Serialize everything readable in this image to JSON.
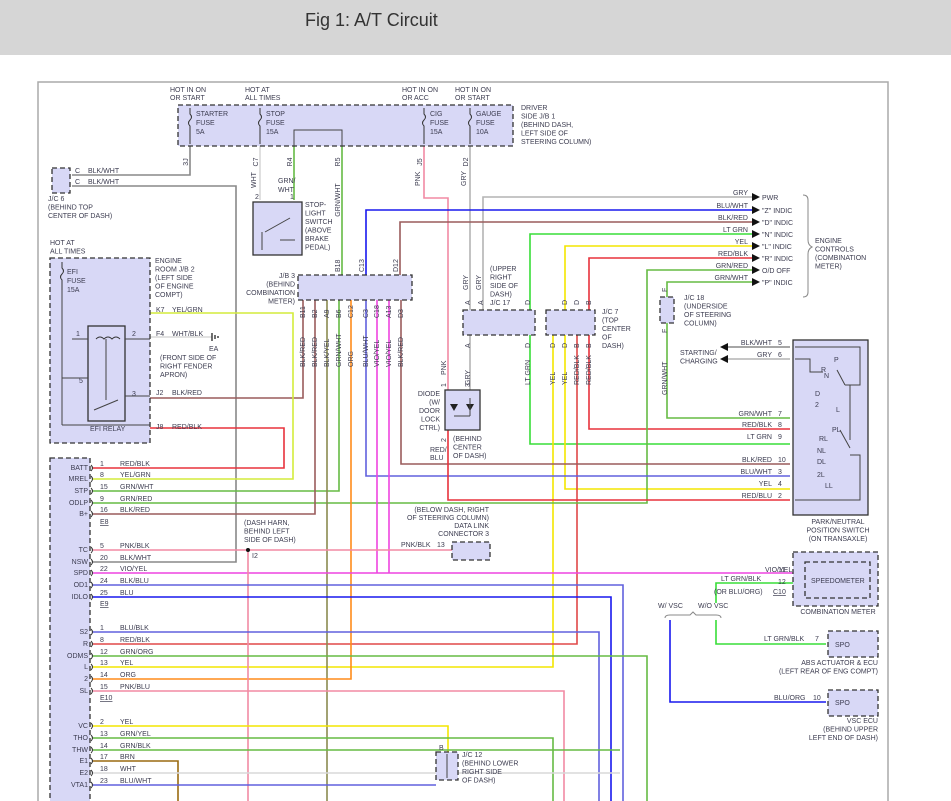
{
  "header": {
    "title": "Fig 1: A/T Circuit"
  },
  "jb1": {
    "hot": [
      [
        "HOT IN ON",
        "OR START"
      ],
      [
        "HOT AT",
        "ALL TIMES"
      ],
      [
        "HOT IN ON",
        "OR ACC"
      ],
      [
        "HOT IN ON",
        "OR START"
      ]
    ],
    "fuses": [
      [
        "STARTER",
        "FUSE",
        "5A"
      ],
      [
        "STOP",
        "FUSE",
        "15A"
      ],
      [
        "CIG",
        "FUSE",
        "15A"
      ],
      [
        "GAUGE",
        "FUSE",
        "10A"
      ]
    ],
    "label": [
      "DRIVER",
      "SIDE J/B 1",
      "(BEHIND DASH,",
      "LEFT SIDE OF",
      "STEERING COLUMN)"
    ],
    "terminals": [
      "3J",
      "C7",
      "R4",
      "R5",
      "J5",
      "D2"
    ],
    "wires": [
      "WHT",
      "GRN/",
      "WHT",
      "GRN/WHT",
      "PNK",
      "GRY"
    ]
  },
  "jc6": {
    "pins": [
      "C",
      "C"
    ],
    "wires": [
      "BLK/WHT",
      "BLK/WHT"
    ],
    "label": [
      "J/C 6",
      "(BEHIND TOP",
      "CENTER OF DASH)"
    ]
  },
  "stop_switch": {
    "pins": [
      "2",
      "1"
    ],
    "label": [
      "STOP-",
      "LIGHT",
      "SWITCH",
      "(ABOVE",
      "BRAKE",
      "PEDAL)"
    ]
  },
  "jb2": {
    "hot": [
      "HOT AT",
      "ALL TIMES"
    ],
    "fuse": [
      "EFI",
      "FUSE",
      "15A"
    ],
    "label": [
      "ENGINE",
      "ROOM J/B 2",
      "(LEFT SIDE",
      "OF ENGINE",
      "COMPT)"
    ],
    "relay": "EFI RELAY",
    "relay_pins": [
      "1",
      "2",
      "5",
      "3"
    ],
    "terminals": [
      {
        "pin": "K7",
        "wire": "YEL/GRN"
      },
      {
        "pin": "F4",
        "wire": "WHT/BLK"
      },
      {
        "pin": "J2",
        "wire": "BLK/RED"
      },
      {
        "pin": "J8",
        "wire": "RED/BLK"
      }
    ],
    "ground": {
      "name": "EA",
      "label": [
        "(FRONT SIDE OF",
        "RIGHT FENDER",
        "APRON)"
      ]
    }
  },
  "jb3": {
    "label": [
      "J/B 3",
      "(BEHIND",
      "COMBINATION",
      "METER)"
    ],
    "top_terminals": [
      "B18",
      "C13",
      "D12"
    ],
    "bottom_terminals": [
      "B11",
      "B2",
      "A9",
      "B6",
      "C12",
      "C3",
      "C18",
      "A13",
      "D3"
    ],
    "bottom_wires": [
      "BLK/RED",
      "BLK/RED",
      "BLK/YEL",
      "GRN/WHT",
      "ORG",
      "BLU/WHT",
      "VIO/YEL",
      "VIO/YEL",
      "BLK/RED"
    ]
  },
  "jc17": {
    "label": [
      "(UPPER",
      "RIGHT",
      "SIDE OF",
      "DASH)",
      "J/C 17"
    ],
    "top_pins": [
      "A",
      "A",
      "D"
    ],
    "top_wires": [
      "GRY",
      "GRY"
    ],
    "bottom_pins": [
      "A",
      "D"
    ],
    "bottom_wires": [
      "GRY",
      "LT GRN"
    ]
  },
  "jc7": {
    "label": [
      "J/C 7",
      "(TOP",
      "CENTER",
      "OF",
      "DASH)"
    ],
    "top_pins": [
      "D",
      "D",
      "B"
    ],
    "bottom_pins": [
      "D",
      "D",
      "B",
      "B"
    ],
    "bottom_wires": [
      "YEL",
      "YEL",
      "RED/BLK",
      "RED/BLK"
    ]
  },
  "diode": {
    "label": [
      "DIODE",
      "(W/",
      "DOOR",
      "LOCK",
      "CTRL)"
    ],
    "pins": [
      "1",
      "3",
      "2"
    ],
    "wires": [
      "PNK",
      "RED/",
      "BLU"
    ],
    "location": [
      "(BEHIND",
      "CENTER",
      "OF DASH)"
    ]
  },
  "jc18": {
    "pins": [
      "F",
      "F"
    ],
    "label": [
      "J/C 18",
      "(UNDERSIDE",
      "OF STEERING",
      "COLUMN)"
    ],
    "wire": "GRN/WHT"
  },
  "meter_outputs": {
    "items": [
      {
        "wire": "GRY",
        "signal": "PWR"
      },
      {
        "wire": "BLU/WHT",
        "signal": "\"Z\" INDIC"
      },
      {
        "wire": "BLK/RED",
        "signal": "\"D\" INDIC"
      },
      {
        "wire": "LT GRN",
        "signal": "\"N\" INDIC"
      },
      {
        "wire": "YEL",
        "signal": "\"L\" INDIC"
      },
      {
        "wire": "RED/BLK",
        "signal": "\"R\" INDIC"
      },
      {
        "wire": "GRN/RED",
        "signal": "O/D OFF"
      },
      {
        "wire": "GRN/WHT",
        "signal": "\"P\" INDIC"
      }
    ],
    "label": [
      "ENGINE",
      "CONTROLS",
      "(COMBINATION",
      "METER)"
    ]
  },
  "pn_switch": {
    "outputs": [
      "STARTING/",
      "CHARGING"
    ],
    "pins": [
      {
        "wire": "BLK/WHT",
        "pin": "5"
      },
      {
        "wire": "GRY",
        "pin": "6"
      },
      {
        "wire": "GRN/WHT",
        "pin": "7"
      },
      {
        "wire": "RED/BLK",
        "pin": "8"
      },
      {
        "wire": "LT GRN",
        "pin": "9"
      },
      {
        "wire": "BLK/RED",
        "pin": "10"
      },
      {
        "wire": "BLU/WHT",
        "pin": "3"
      },
      {
        "wire": "YEL",
        "pin": "4"
      },
      {
        "wire": "RED/BLU",
        "pin": "2"
      }
    ],
    "positions": [
      "P",
      "R",
      "N",
      "D",
      "2",
      "L",
      "PL",
      "RL",
      "NL",
      "DL",
      "2L",
      "LL"
    ],
    "label": [
      "PARK/NEUTRAL",
      "POSITION SWITCH",
      "(ON TRANSAXLE)"
    ]
  },
  "combo_meter": {
    "inner": "SPEEDOMETER",
    "name": "COMBINATION METER",
    "pins": [
      {
        "pin": "11",
        "wire": "VIO/YEL"
      },
      {
        "pin": "12",
        "wire": "LT GRN/BLK"
      }
    ],
    "alt_wire": "(OR BLU/ORG)",
    "connector": "C10"
  },
  "vsc": {
    "with": "W/ VSC",
    "without": "W/O VSC"
  },
  "abs": {
    "pin": "7",
    "wire": "LT GRN/BLK",
    "terminal": "SPO",
    "label": [
      "ABS ACTUATOR & ECU",
      "(LEFT REAR OF ENG COMPT)"
    ]
  },
  "vsc_ecu": {
    "pin": "10",
    "wire": "BLU/ORG",
    "terminal": "SPO",
    "label": [
      "VSC ECU",
      "(BEHIND UPPER",
      "LEFT END OF DASH)"
    ]
  },
  "dlc3": {
    "label": [
      "(BELOW DASH, RIGHT",
      "OF STEERING COLUMN)",
      "DATA LINK",
      "CONNECTOR 3"
    ],
    "pin": "13",
    "wire": "PNK/BLK"
  },
  "dash_harn": {
    "label": [
      "(DASH HARN,",
      "BEHIND LEFT",
      "SIDE OF DASH)"
    ],
    "junction": "I2"
  },
  "jc12": {
    "pin": "B",
    "label": [
      "J/C 12",
      "(BEHIND LOWER",
      "RIGHT SIDE",
      "OF DASH)"
    ]
  },
  "ecm": {
    "connectors": [
      {
        "name": "E8",
        "rows": [
          {
            "term": "BATT",
            "pin": "1",
            "wire": "RED/BLK"
          },
          {
            "term": "MREL",
            "pin": "8",
            "wire": "YEL/GRN"
          },
          {
            "term": "STP",
            "pin": "15",
            "wire": "GRN/WHT"
          },
          {
            "term": "ODLP",
            "pin": "9",
            "wire": "GRN/RED"
          },
          {
            "term": "B+",
            "pin": "16",
            "wire": "BLK/RED"
          }
        ]
      },
      {
        "name": "E9",
        "rows": [
          {
            "term": "TC",
            "pin": "5",
            "wire": "PNK/BLK"
          },
          {
            "term": "NSW",
            "pin": "20",
            "wire": "BLK/WHT"
          },
          {
            "term": "SPD",
            "pin": "22",
            "wire": "VIO/YEL"
          },
          {
            "term": "OD1",
            "pin": "24",
            "wire": "BLK/BLU"
          },
          {
            "term": "IDLO",
            "pin": "25",
            "wire": "BLU"
          }
        ]
      },
      {
        "name": "E10",
        "rows": [
          {
            "term": "S2",
            "pin": "1",
            "wire": "BLU/BLK"
          },
          {
            "term": "R",
            "pin": "8",
            "wire": "RED/BLK"
          },
          {
            "term": "ODMS",
            "pin": "12",
            "wire": "GRN/ORG"
          },
          {
            "term": "L",
            "pin": "13",
            "wire": "YEL"
          },
          {
            "term": "2",
            "pin": "14",
            "wire": "ORG"
          },
          {
            "term": "SL",
            "pin": "15",
            "wire": "PNK/BLU"
          }
        ]
      },
      {
        "name": "",
        "rows": [
          {
            "term": "VC",
            "pin": "2",
            "wire": "YEL"
          },
          {
            "term": "THO",
            "pin": "13",
            "wire": "GRN/YEL"
          },
          {
            "term": "THW",
            "pin": "14",
            "wire": "GRN/BLK"
          },
          {
            "term": "E1",
            "pin": "17",
            "wire": "BRN"
          },
          {
            "term": "E2",
            "pin": "18",
            "wire": "WHT"
          },
          {
            "term": "VTA1",
            "pin": "23",
            "wire": "BLU/WHT"
          }
        ]
      }
    ]
  }
}
